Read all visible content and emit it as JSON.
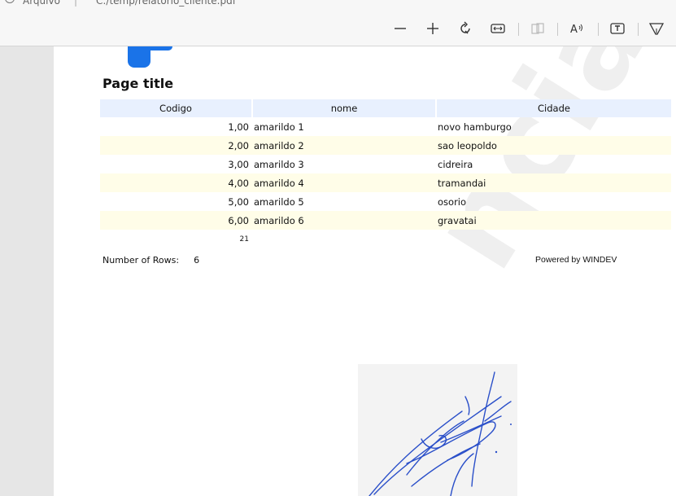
{
  "address_bar": {
    "label": "Arquivo",
    "separator": "|",
    "path": "C:/temp/relatorio_cliente.pdf"
  },
  "toolbar": {
    "icons": [
      "zoom-out-icon",
      "zoom-in-icon",
      "rotate-icon",
      "fit-width-icon",
      "page-view-icon",
      "read-aloud-icon",
      "text-icon",
      "draw-icon"
    ]
  },
  "report": {
    "title": "Page title",
    "columns": [
      "Codigo",
      "nome",
      "Cidade"
    ],
    "rows": [
      {
        "codigo": "1,00",
        "nome": "amarildo 1",
        "cidade": "novo hamburgo"
      },
      {
        "codigo": "2,00",
        "nome": "amarildo 2",
        "cidade": "sao leopoldo"
      },
      {
        "codigo": "3,00",
        "nome": "amarildo 3",
        "cidade": "cidreira"
      },
      {
        "codigo": "4,00",
        "nome": "amarildo 4",
        "cidade": "tramandai"
      },
      {
        "codigo": "5,00",
        "nome": "amarildo 5",
        "cidade": "osorio"
      },
      {
        "codigo": "6,00",
        "nome": "amarildo 6",
        "cidade": "gravatai"
      }
    ],
    "total": "21",
    "rows_label": "Number of Rows:",
    "rows_count": "6",
    "powered_by": "Powered by WINDEV",
    "watermark": "ncial"
  },
  "colors": {
    "header_bg": "#e8f0fe",
    "alt_row_bg": "#fffde8",
    "logo": "#1a73e8",
    "signature_ink": "#2a4fc9"
  }
}
